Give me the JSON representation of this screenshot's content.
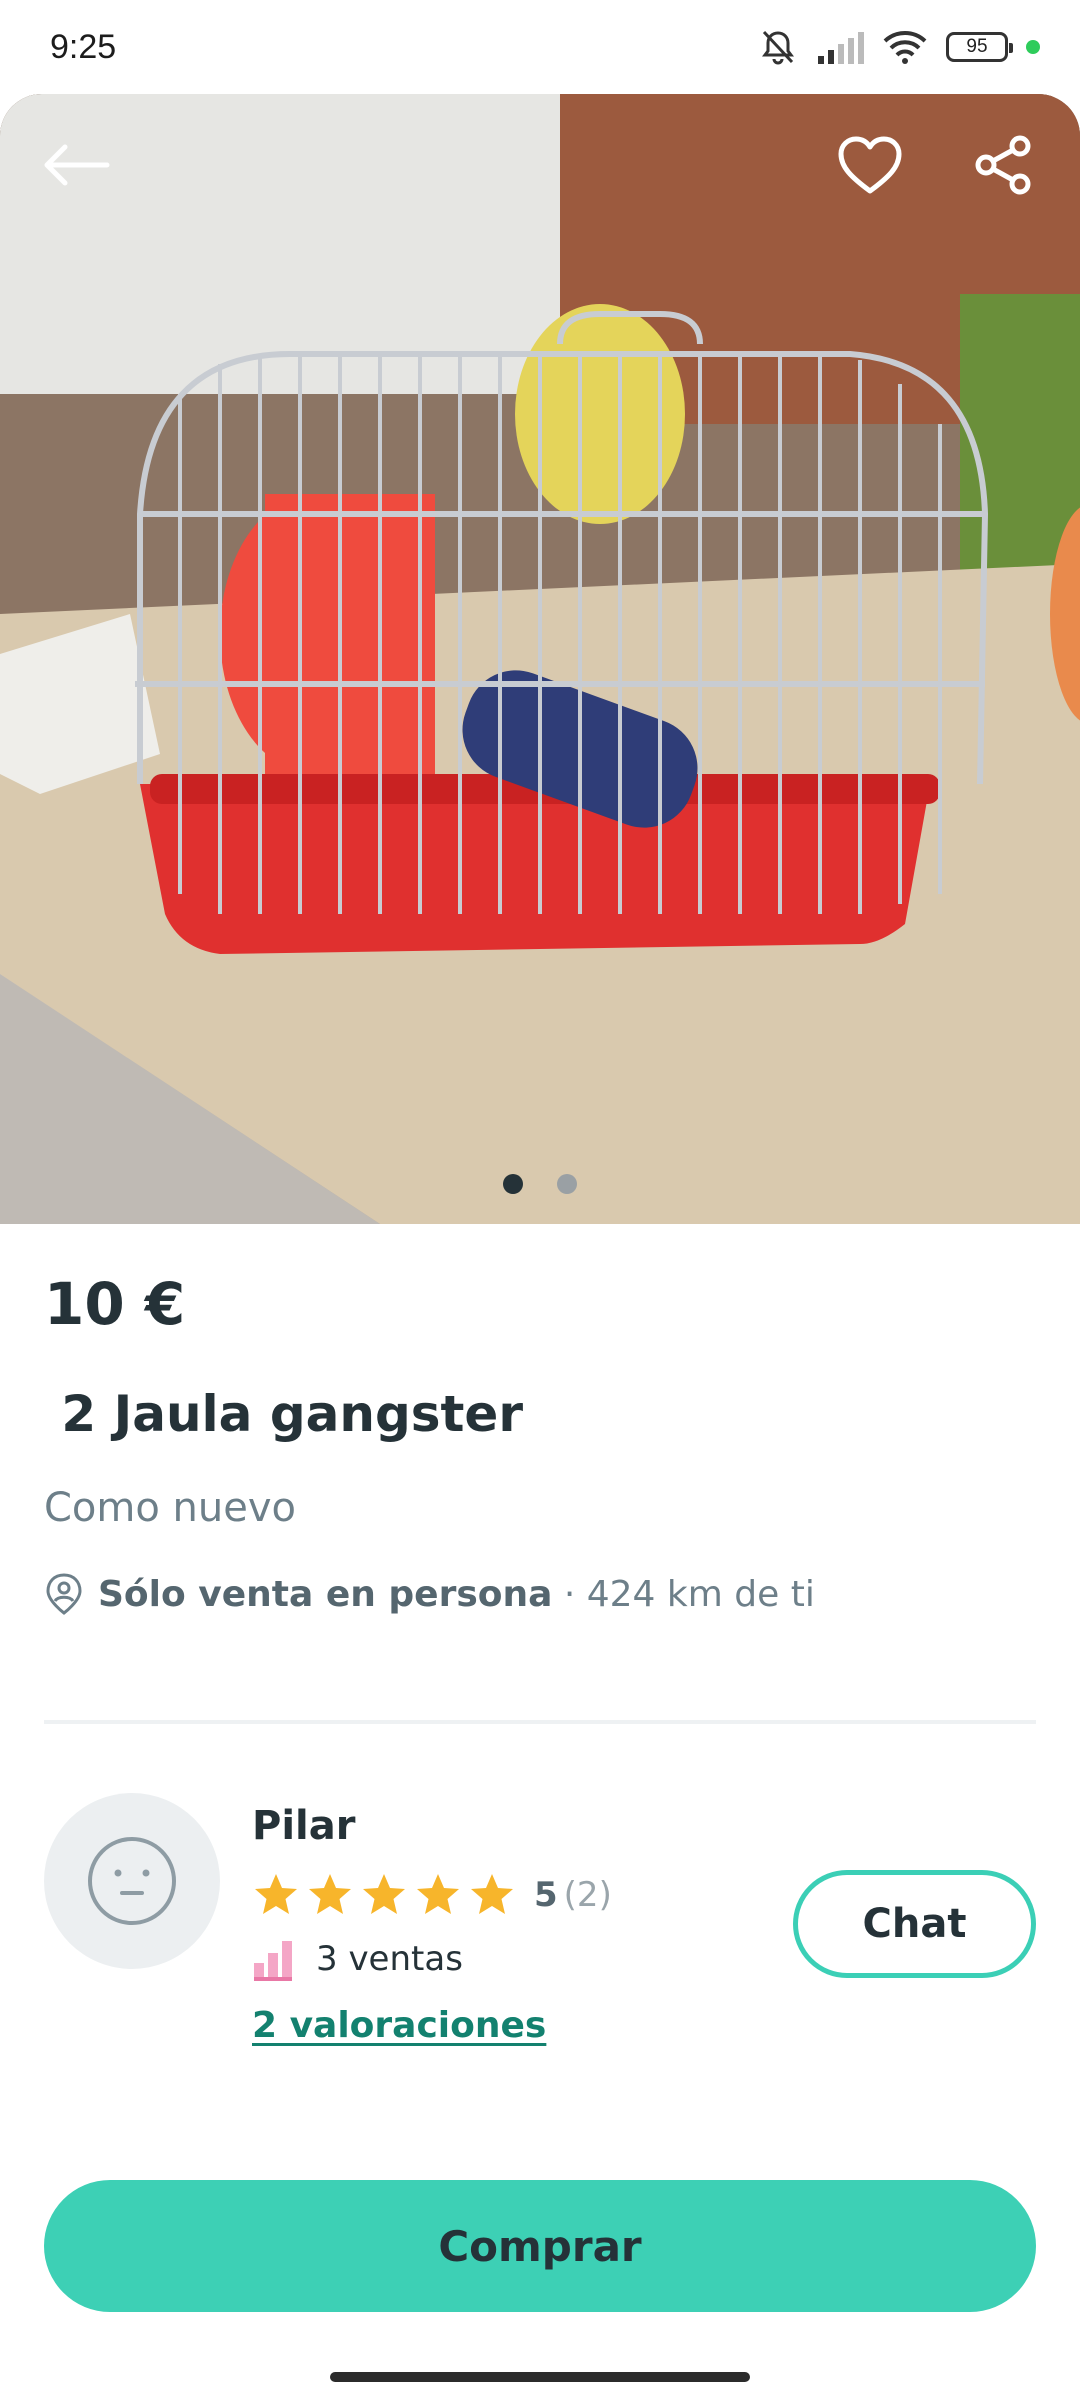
{
  "status_bar": {
    "time": "9:25",
    "battery": "95",
    "icons": [
      "bell-muted-icon",
      "signal-icon",
      "wifi-icon",
      "battery-icon"
    ]
  },
  "gallery": {
    "image_count": 2,
    "active_index": 0,
    "icons": {
      "back": "arrow-left-icon",
      "favorite": "heart-icon",
      "share": "share-icon"
    }
  },
  "item": {
    "price": "10 €",
    "title": " 2 Jaula gangster",
    "condition": "Como nuevo",
    "delivery": "Sólo venta en persona",
    "distance": " · 424 km de ti"
  },
  "seller": {
    "name": "Pilar",
    "rating_value": "5",
    "rating_count": "(2)",
    "stars": 5,
    "sales": "3 ventas",
    "reviews_link": "2 valoraciones",
    "chat_label": "Chat"
  },
  "actions": {
    "buy_label": "Comprar"
  },
  "colors": {
    "accent": "#3dd0b5",
    "link": "#13816f",
    "star": "#f7b52b",
    "text": "#253238",
    "muted": "#6d7f89"
  }
}
